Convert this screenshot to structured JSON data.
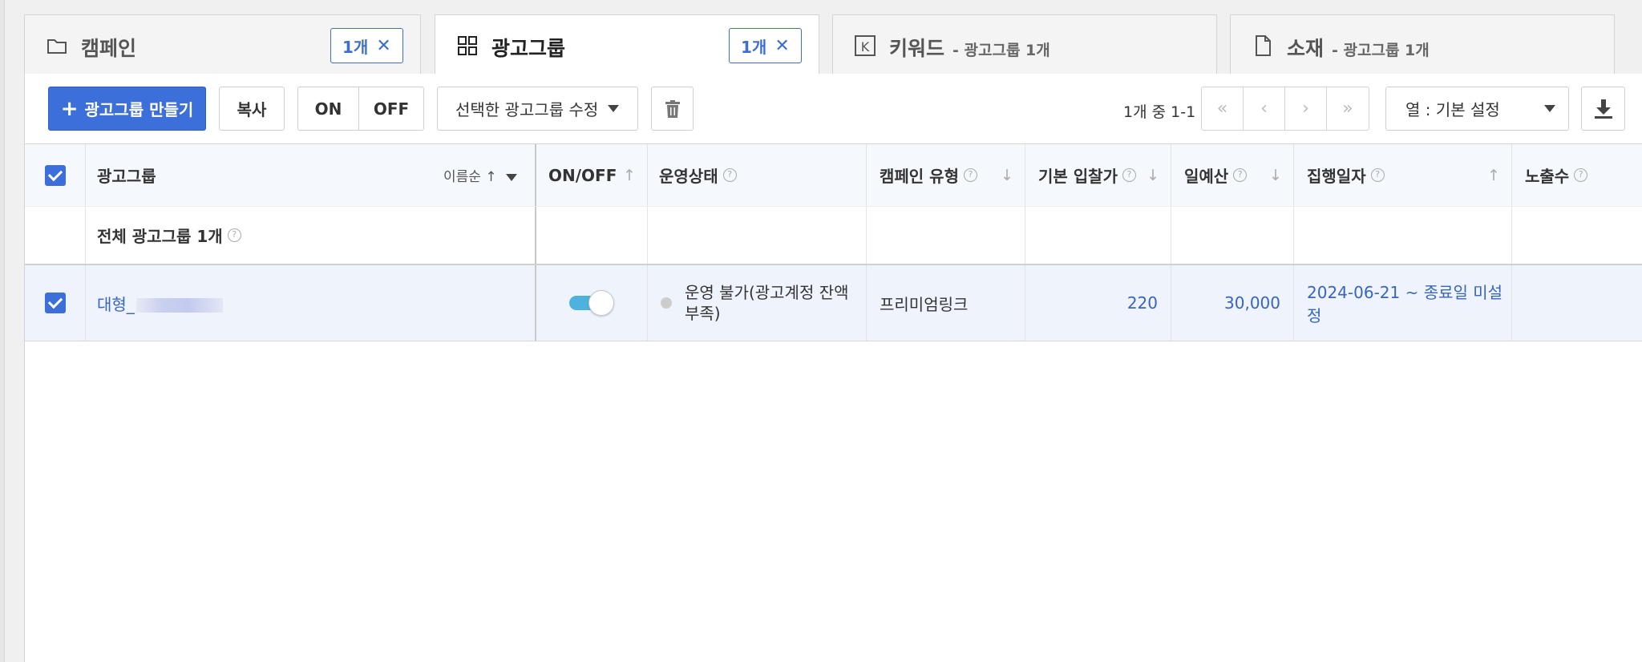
{
  "tabs": [
    {
      "label": "캠페인",
      "chip": "1개",
      "icon": "folder-icon"
    },
    {
      "label": "광고그룹",
      "chip": "1개",
      "icon": "grid-icon"
    },
    {
      "label": "키워드",
      "sub": "- 광고그룹 1개",
      "icon": "keyword-icon"
    },
    {
      "label": "소재",
      "sub": "- 광고그룹 1개",
      "icon": "document-icon"
    }
  ],
  "toolbar": {
    "create_label": "광고그룹 만들기",
    "copy_label": "복사",
    "on_label": "ON",
    "off_label": "OFF",
    "edit_selected_label": "선택한 광고그룹 수정",
    "pager_text": "1개 중 1-1",
    "columns_label": "열 : 기본 설정"
  },
  "table": {
    "headers": {
      "adgroup": "광고그룹",
      "sort": "이름순",
      "onoff": "ON/OFF",
      "status": "운영상태",
      "campaign_type": "캠페인 유형",
      "bid": "기본 입찰가",
      "budget": "일예산",
      "period": "집행일자",
      "impressions": "노출수"
    },
    "summary_label": "전체 광고그룹 1개",
    "rows": [
      {
        "name": "대형_",
        "on": true,
        "status": "운영 불가(광고계정 잔액 부족)",
        "campaign_type": "프리미엄링크",
        "bid": "220",
        "budget": "30,000",
        "period": "2024-06-21 ~ 종료일 미설정",
        "impressions": ""
      }
    ]
  },
  "colors": {
    "primary": "#3c6fd9",
    "link": "#3864c4",
    "toggle": "#4fb1de",
    "selected_row": "#eef3fc"
  }
}
